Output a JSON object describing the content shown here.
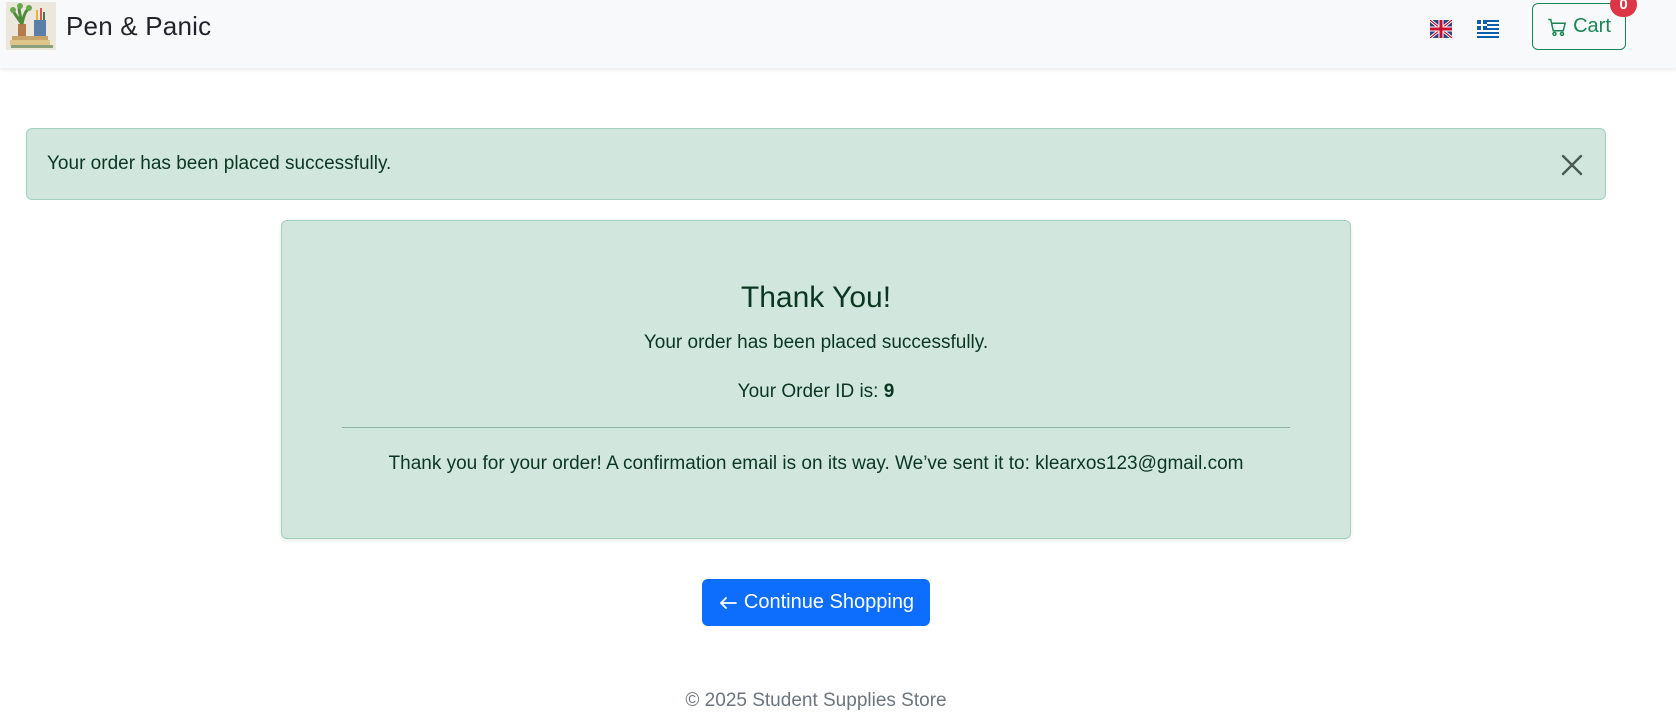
{
  "navbar": {
    "brand_name": "Pen & Panic",
    "languages": [
      {
        "name": "English",
        "icon": "uk-flag-icon"
      },
      {
        "name": "Greek",
        "icon": "greek-flag-icon"
      }
    ],
    "cart_label": "Cart",
    "cart_count": "0",
    "cart_icon": "cart-icon"
  },
  "alert": {
    "message": "Your order has been placed successfully.",
    "close_icon": "close-icon"
  },
  "confirmation": {
    "title": "Thank You!",
    "message": "Your order has been placed successfully.",
    "order_id_label": "Your Order ID is:",
    "order_id": "9",
    "email_text": "Thank you for your order! A confirmation email is on its way. We’ve sent it to: klearxos123@gmail.com"
  },
  "actions": {
    "continue_label": "Continue Shopping",
    "continue_icon": "arrow-left-icon"
  },
  "footer": {
    "copyright": "© 2025 Student Supplies Store"
  },
  "colors": {
    "success_bg": "#d1e7dd",
    "success_border": "#a3cfbb",
    "success_text": "#0a3622",
    "primary": "#0d6efd",
    "cart_green": "#198754",
    "badge_red": "#dc3545"
  }
}
